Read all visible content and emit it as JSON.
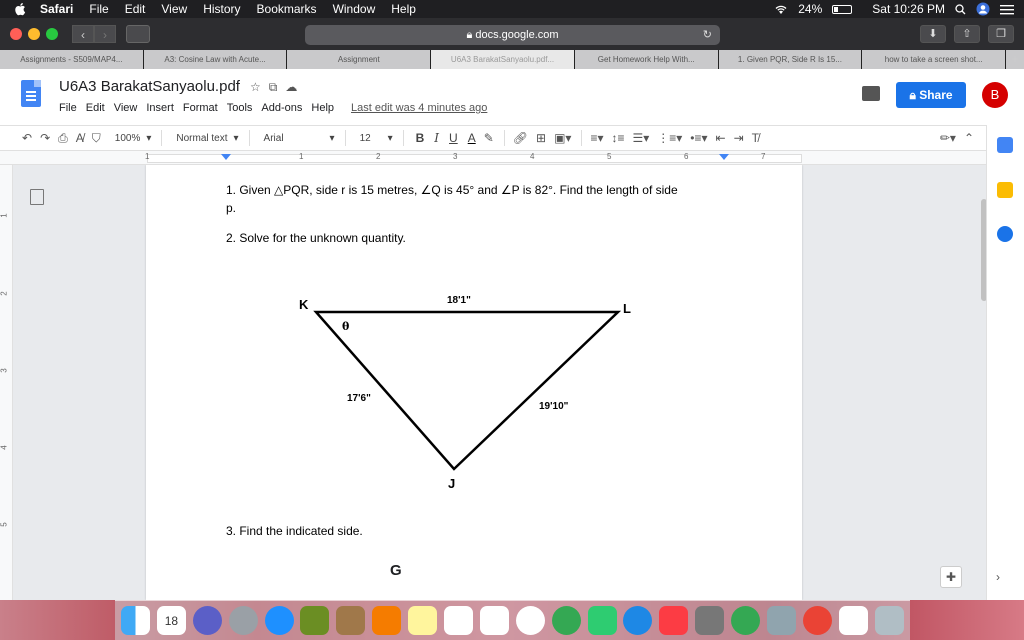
{
  "menubar": {
    "items": [
      "Safari",
      "File",
      "Edit",
      "View",
      "History",
      "Bookmarks",
      "Window",
      "Help"
    ],
    "battery": "24%",
    "battery_level": 0.24,
    "clock": "Sat 10:26 PM"
  },
  "safari": {
    "url": "docs.google.com"
  },
  "tabs": [
    "Assignments - S509/MAP4...",
    "A3: Cosine Law with Acute...",
    "Assignment",
    "U6A3 BarakatSanyaolu.pdf...",
    "Get Homework Help With...",
    "1. Given PQR, Side R Is 15...",
    "how to take a screen shot..."
  ],
  "active_tab_index": 3,
  "docs": {
    "title": "U6A3 BarakatSanyaolu.pdf",
    "menu": [
      "File",
      "Edit",
      "View",
      "Insert",
      "Format",
      "Tools",
      "Add-ons",
      "Help"
    ],
    "last_edit": "Last edit was 4 minutes ago",
    "share": "Share",
    "avatar_letter": "B"
  },
  "toolbar": {
    "zoom": "100%",
    "style": "Normal text",
    "font": "Arial",
    "size": "12",
    "bold": "B",
    "italic": "I",
    "underline": "U",
    "text_color": "A"
  },
  "ruler": {
    "numbers": [
      "1",
      "1",
      "2",
      "3",
      "4",
      "5",
      "6",
      "7"
    ],
    "vertical": [
      "1",
      "2",
      "3",
      "4",
      "5"
    ]
  },
  "document": {
    "q1_line1": "1. Given △PQR, side r is 15 metres, ∠Q is 45° and ∠P is 82°. Find the length of side",
    "q1_line2": "p.",
    "q2": "2. Solve for the unknown quantity.",
    "q3": "3. Find the indicated side.",
    "triangle": {
      "vertex_k": "K",
      "vertex_l": "L",
      "vertex_j": "J",
      "side_kl": "18'1\"",
      "side_kj": "17'6\"",
      "side_lj": "19'10\"",
      "angle": "θ"
    },
    "next_vertex": "G"
  },
  "dock": {
    "calendar_day": "18"
  },
  "colors": {
    "menubar": "#1f1f22",
    "share": "#1a73e8",
    "avatar": "#d50000",
    "docs_blue": "#4285f4"
  }
}
